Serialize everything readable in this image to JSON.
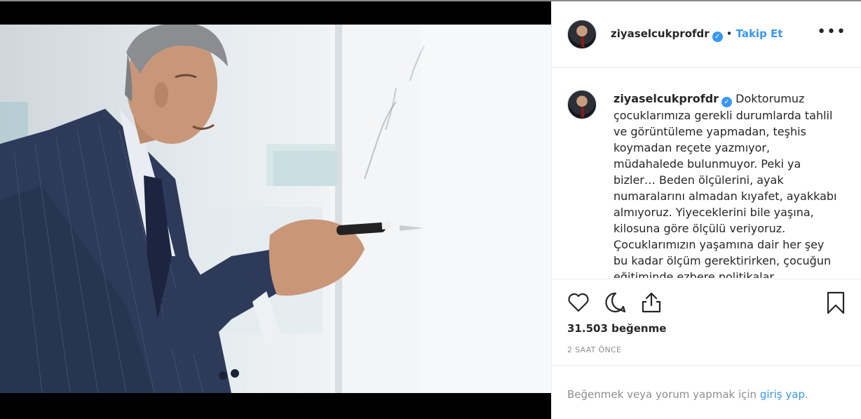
{
  "post": {
    "username": "ziyaselcukprofdr",
    "follow_label": "Takip Et",
    "separator": "•",
    "more_label": "•••",
    "verified_mark": "✓",
    "caption": "Doktorumuz çocuklarımıza gerekli durumlarda tahlil ve görüntüleme yapmadan, teşhis koymadan reçete yazmıyor, müdahalede bulunmuyor. Peki ya bizler… Beden ölçülerini, ayak numaralarını almadan kıyafet, ayakkabı almıyoruz. Yiyeceklerini bile yaşına, kilosuna göre ölçülü veriyoruz. Çocuklarımızın yaşamına dair her şey bu kadar ölçüm gerektirirken, çocuğun eğitiminde ezbere politikalar",
    "likes": "31.503 beğenme",
    "time": "2 SAAT ÖNCE",
    "login_prefix": "Beğenmek veya yorum yapmak için ",
    "login_link": "giriş yap",
    "login_suffix": "."
  },
  "icons": {
    "like": "heart-icon",
    "comment": "comment-icon",
    "share": "share-icon",
    "save": "bookmark-icon",
    "more": "more-options-icon",
    "verified": "verified-badge-icon"
  },
  "colors": {
    "accent": "#3897f0",
    "text": "#262626",
    "muted": "#8e8e8e",
    "border": "#efefef"
  }
}
